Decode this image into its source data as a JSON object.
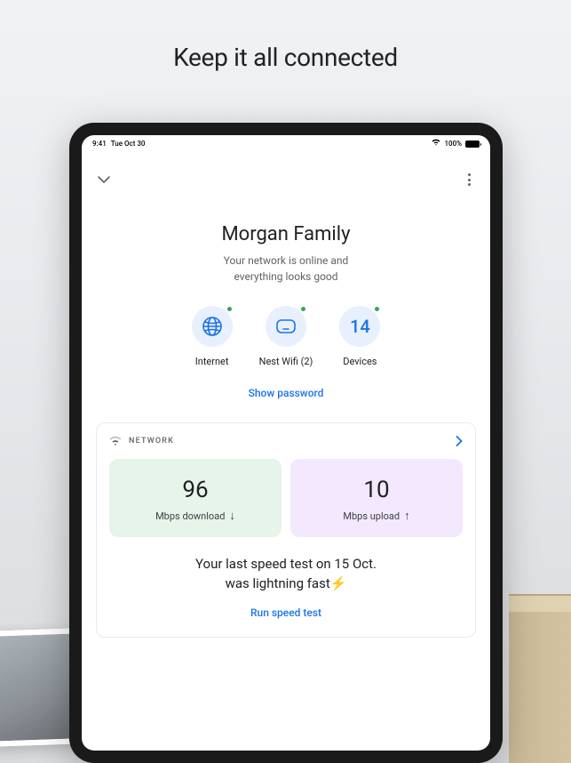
{
  "promo": {
    "title": "Keep it all connected"
  },
  "statusBar": {
    "time": "9:41",
    "date": "Tue Oct 30",
    "battery": "100%"
  },
  "network": {
    "title": "Morgan Family",
    "subtitle_line1": "Your network is online and",
    "subtitle_line2": "everything looks good",
    "items": [
      {
        "label": "Internet"
      },
      {
        "label": "Nest Wifi (2)"
      },
      {
        "label": "Devices",
        "count": "14"
      }
    ],
    "show_password": "Show password"
  },
  "card": {
    "header": "NETWORK",
    "download": {
      "value": "96",
      "label": "Mbps download"
    },
    "upload": {
      "value": "10",
      "label": "Mbps upload"
    },
    "message_line1": "Your last speed test on 15 Oct.",
    "message_line2": "was lightning fast⚡",
    "run_test": "Run speed test"
  }
}
